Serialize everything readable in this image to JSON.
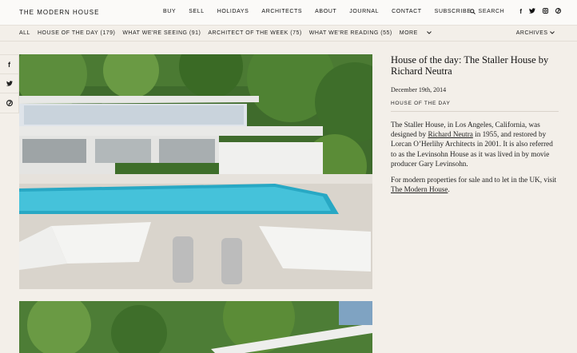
{
  "header": {
    "logo": "THE MODERN HOUSE",
    "nav": [
      "BUY",
      "SELL",
      "HOLIDAYS",
      "ARCHITECTS",
      "ABOUT",
      "JOURNAL",
      "CONTACT",
      "SUBSCRIBE"
    ],
    "search_label": "SEARCH",
    "social": [
      "f",
      "t",
      "instagram",
      "pinterest"
    ]
  },
  "categories": {
    "items": [
      "ALL",
      "HOUSE OF THE DAY (179)",
      "WHAT WE'RE SEEING (91)",
      "ARCHITECT OF THE WEEK (75)",
      "WHAT WE'RE READING (55)",
      "MORE"
    ],
    "archives_label": "ARCHIVES"
  },
  "share": {
    "facebook": "f",
    "twitter": "t",
    "pinterest": "p"
  },
  "article": {
    "title": "House of the day: The Staller House by Richard Neutra",
    "date": "December 19th, 2014",
    "tag": "HOUSE OF THE DAY",
    "p1_a": "The Staller House, in Los Angeles, California, was designed by ",
    "p1_link": "Richard Neutra",
    "p1_b": " in 1955, and restored by Lorcan O’Herlihy Architects in 2001. It is also referred to as the Levinsohn House as it was lived in by movie producer Gary Levinsohn.",
    "p2_a": "For modern properties for sale and to let in the UK, visit ",
    "p2_link": "The Modern House",
    "p2_b": "."
  }
}
